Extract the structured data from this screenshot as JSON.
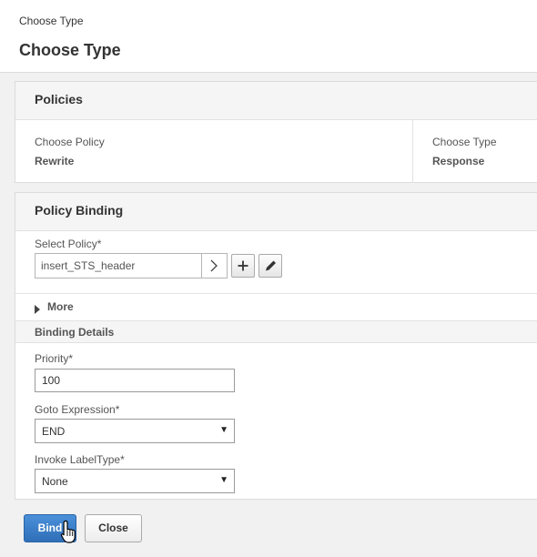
{
  "header": {
    "breadcrumb": "Choose Type",
    "title": "Choose Type"
  },
  "policies": {
    "title": "Policies",
    "choose_policy_label": "Choose Policy",
    "choose_policy_value": "Rewrite",
    "choose_type_label": "Choose Type",
    "choose_type_value": "Response"
  },
  "policy_binding": {
    "title": "Policy Binding",
    "select_policy_label": "Select Policy*",
    "select_policy_value": "insert_STS_header",
    "icons": {
      "select": "chevron-right-icon",
      "add": "plus-icon",
      "edit": "pencil-icon"
    },
    "more_label": "More",
    "binding_details_title": "Binding Details",
    "priority_label": "Priority*",
    "priority_value": "100",
    "goto_label": "Goto Expression*",
    "goto_value": "END",
    "invoke_label": "Invoke LabelType*",
    "invoke_value": "None"
  },
  "footer": {
    "bind_label": "Bind",
    "close_label": "Close"
  },
  "colors": {
    "primary_button": "#3a7dc9",
    "background": "#f1f1f1"
  }
}
